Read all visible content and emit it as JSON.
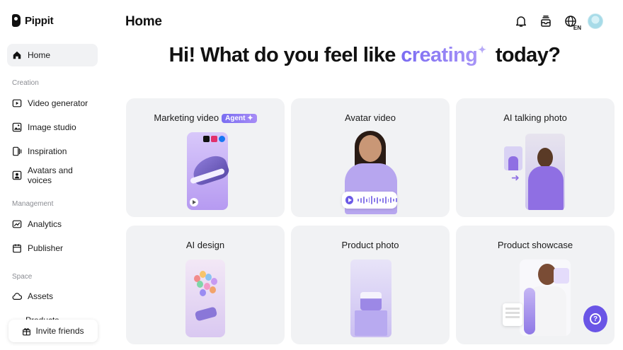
{
  "app": {
    "name": "Pippit"
  },
  "header": {
    "title": "Home",
    "lang_badge": "EN"
  },
  "hero": {
    "prefix": "Hi! What do you feel like ",
    "accent": "creating",
    "suffix": " today?"
  },
  "sidebar": {
    "home": "Home",
    "sections": [
      {
        "label": "Creation",
        "items": [
          "Video generator",
          "Image studio",
          "Inspiration",
          "Avatars and voices"
        ]
      },
      {
        "label": "Management",
        "items": [
          "Analytics",
          "Publisher"
        ]
      },
      {
        "label": "Space",
        "items": [
          "Assets",
          "Products"
        ]
      }
    ],
    "invite": "Invite friends"
  },
  "cards": [
    {
      "title": "Marketing video",
      "badge": "Agent ✦"
    },
    {
      "title": "Avatar video"
    },
    {
      "title": "AI talking photo"
    },
    {
      "title": "AI design"
    },
    {
      "title": "Product photo"
    },
    {
      "title": "Product showcase"
    }
  ],
  "colors": {
    "accent": "#7b6cf2",
    "card_bg": "#f1f2f4",
    "help_button": "#6a55e6"
  },
  "icons": [
    "home-icon",
    "video-icon",
    "image-icon",
    "inspiration-icon",
    "avatar-icon",
    "analytics-icon",
    "calendar-icon",
    "cloud-icon",
    "gift-icon",
    "bell-icon",
    "inbox-icon",
    "globe-icon",
    "help-icon"
  ]
}
